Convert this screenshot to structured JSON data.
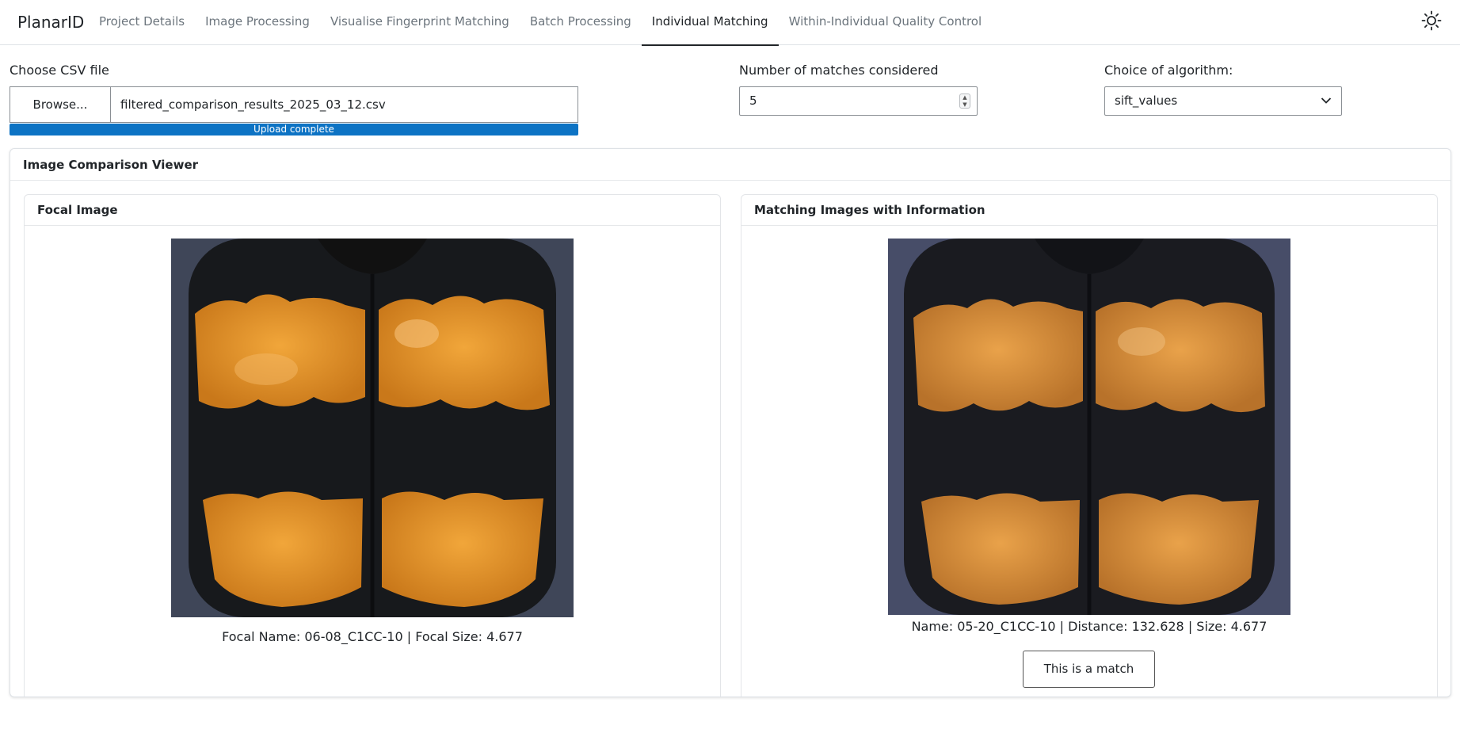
{
  "app": {
    "title": "PlanarID"
  },
  "nav": {
    "tabs": [
      {
        "label": "Project Details"
      },
      {
        "label": "Image Processing"
      },
      {
        "label": "Visualise Fingerprint Matching"
      },
      {
        "label": "Batch Processing"
      },
      {
        "label": "Individual Matching"
      },
      {
        "label": "Within-Individual Quality Control"
      }
    ],
    "active": "Individual Matching",
    "theme_icon": "sun-icon"
  },
  "csv": {
    "label": "Choose CSV file",
    "browse_label": "Browse...",
    "file_name": "filtered_comparison_results_2025_03_12.csv",
    "upload_status": "Upload complete",
    "upload_progress": 1.0,
    "progress_color": "#0d73c4"
  },
  "matches": {
    "label": "Number of matches considered",
    "value": "5"
  },
  "algorithm": {
    "label": "Choice of algorithm:",
    "selected": "sift_values"
  },
  "viewer": {
    "title": "Image Comparison Viewer",
    "focal": {
      "title": "Focal Image",
      "caption": "Focal Name: 06-08_C1CC-10 | Focal Size: 4.677"
    },
    "matching": {
      "title": "Matching Images with Information",
      "caption": "Name: 05-20_C1CC-10 | Distance: 132.628 | Size: 4.677",
      "match_button": "This is a match"
    }
  }
}
